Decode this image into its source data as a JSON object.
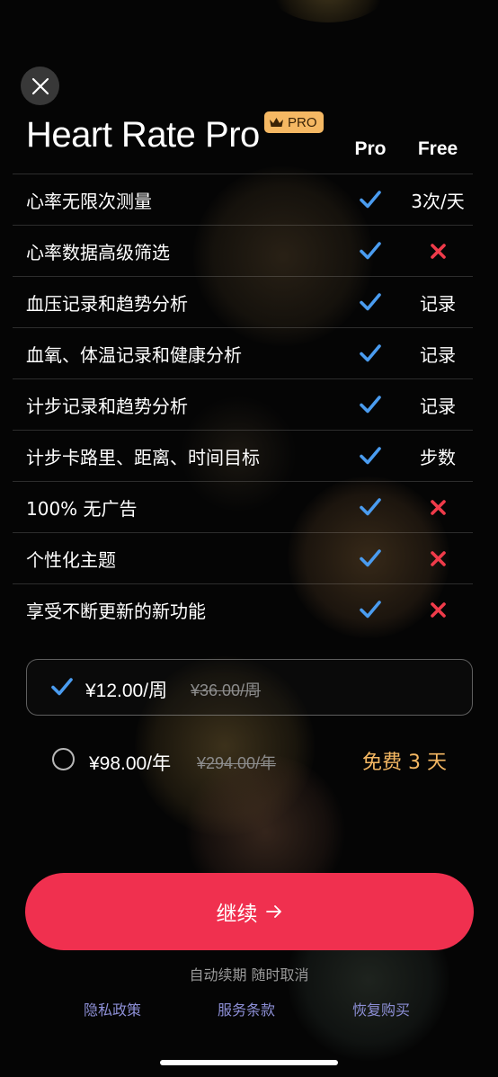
{
  "header": {
    "title": "Heart Rate Pro",
    "badge": "PRO",
    "columns": {
      "pro": "Pro",
      "free": "Free"
    }
  },
  "features": [
    {
      "label": "心率无限次测量",
      "pro": "check",
      "free_text": "3次/天"
    },
    {
      "label": "心率数据高级筛选",
      "pro": "check",
      "free_text": ""
    },
    {
      "label": "血压记录和趋势分析",
      "pro": "check",
      "free_text": "记录"
    },
    {
      "label": "血氧、体温记录和健康分析",
      "pro": "check",
      "free_text": "记录"
    },
    {
      "label": "计步记录和趋势分析",
      "pro": "check",
      "free_text": "记录"
    },
    {
      "label": "计步卡路里、距离、时间目标",
      "pro": "check",
      "free_text": "步数"
    },
    {
      "label": "100% 无广告",
      "pro": "check",
      "free_text": ""
    },
    {
      "label": "个性化主题",
      "pro": "check",
      "free_text": ""
    },
    {
      "label": "享受不断更新的新功能",
      "pro": "check",
      "free_text": ""
    }
  ],
  "plans": {
    "weekly": {
      "price": "¥12.00/周",
      "original": "¥36.00/周",
      "selected": true
    },
    "yearly": {
      "price": "¥98.00/年",
      "original": "¥294.00/年",
      "trial": "免费 3 天",
      "selected": false
    }
  },
  "cta": {
    "label": "继续"
  },
  "renew_note": "自动续期  随时取消",
  "footer": {
    "privacy": "隐私政策",
    "terms": "服务条款",
    "restore": "恢复购买"
  },
  "icons": {
    "close": "close-icon",
    "crown": "crown-icon",
    "check": "checkmark-icon",
    "cross": "cross-icon",
    "arrow": "arrow-right-icon"
  },
  "colors": {
    "background": "#050505",
    "check": "#4a9cf0",
    "cross": "#ef3b4a",
    "accent_gold": "#f5b863",
    "button": "#f0304f",
    "link": "#8d8fd6"
  }
}
